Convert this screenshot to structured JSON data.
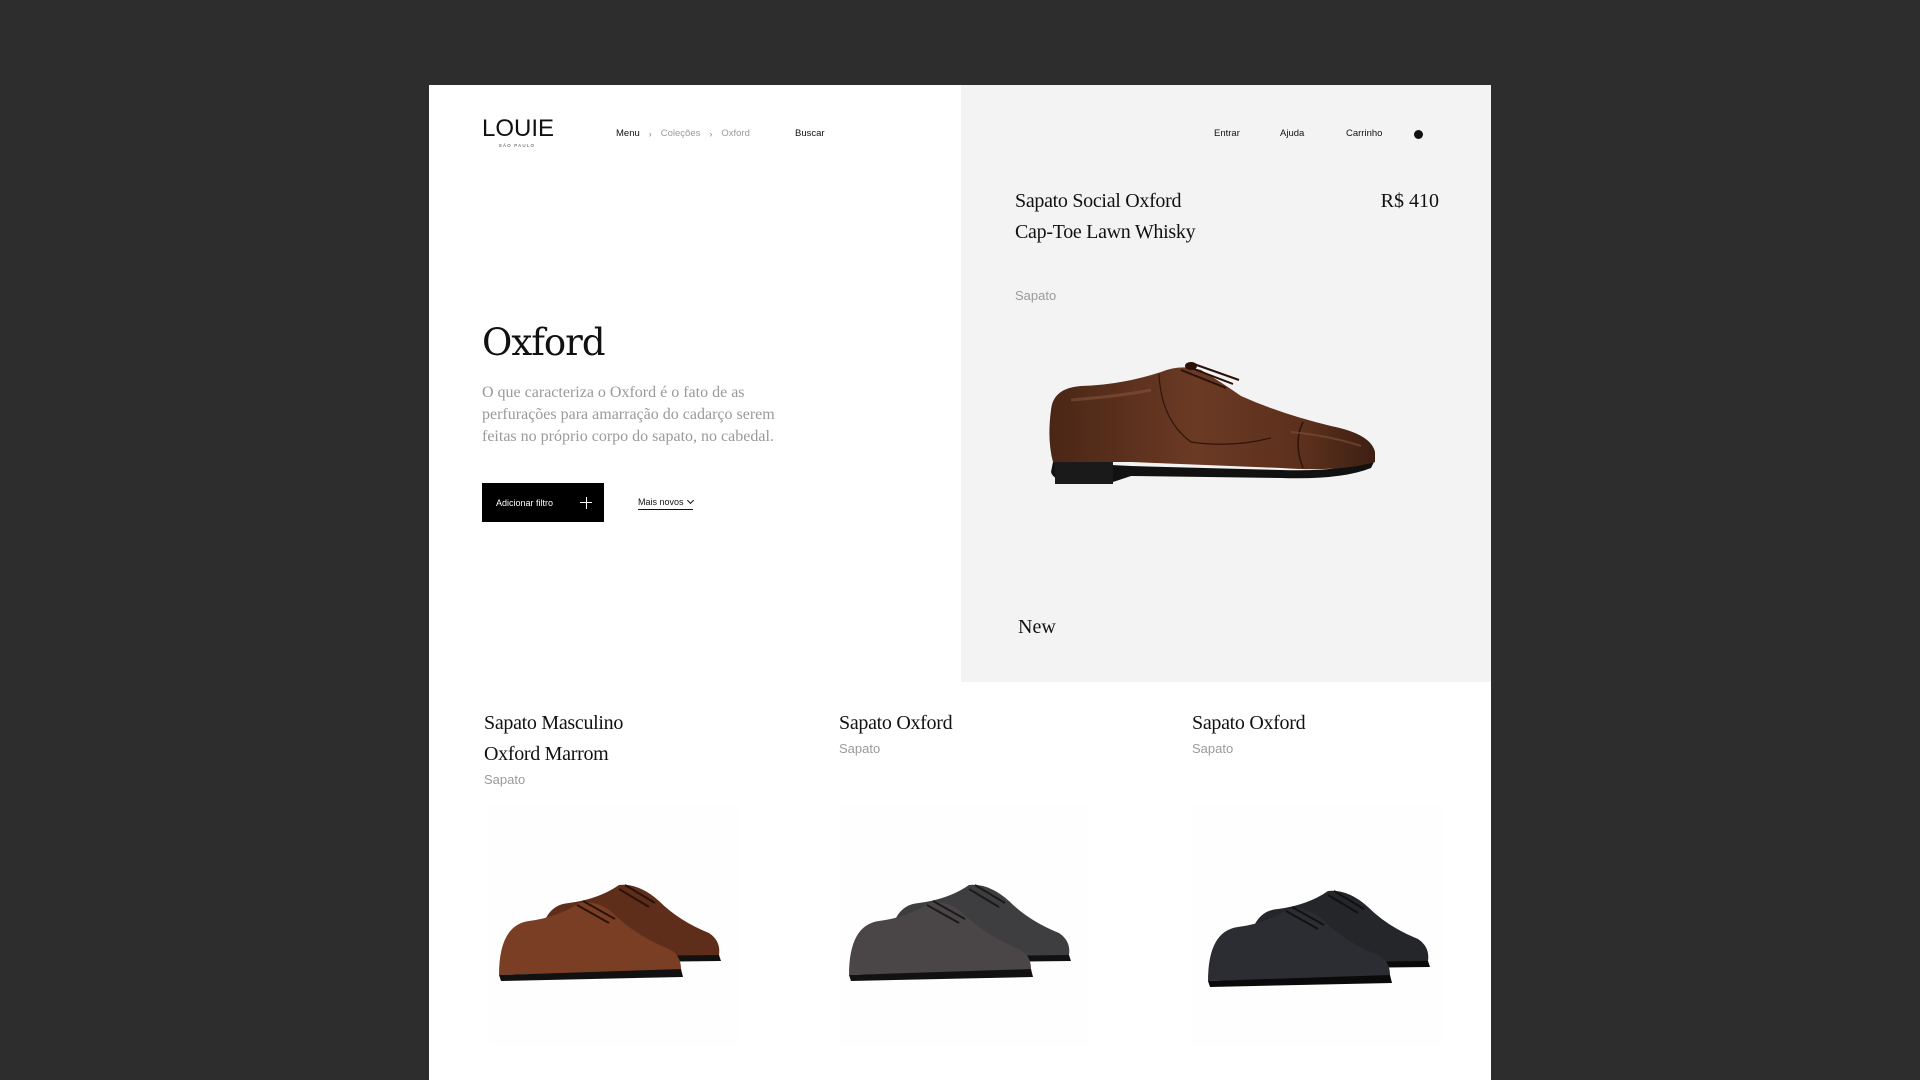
{
  "brand": {
    "name": "LOUIE",
    "sub": "SÃO PAULO"
  },
  "breadcrumb": {
    "items": [
      "Menu",
      "Coleções",
      "Oxford"
    ],
    "sep": "›"
  },
  "search_label": "Buscar",
  "nav": {
    "login": "Entrar",
    "help": "Ajuda",
    "cart": "Carrinho"
  },
  "hero": {
    "title": "Oxford",
    "description": "O que caracteriza o Oxford é o fato de as perfurações para amarração do cadarço serem feitas no próprio corpo do sapato, no cabedal.",
    "filter_button": "Adicionar filtro",
    "sort_label": "Mais novos"
  },
  "featured": {
    "name": "Sapato Social Oxford Cap-Toe Lawn Whisky",
    "price": "R$ 410",
    "category": "Sapato",
    "badge": "New",
    "image_icon": "brown-oxford-shoe-side"
  },
  "products": [
    {
      "name": "Sapato Masculino Oxford Marrom",
      "category": "Sapato",
      "image_icon": "brown-oxford-pair"
    },
    {
      "name": "Sapato Oxford",
      "category": "Sapato",
      "image_icon": "dark-grey-oxford-pair"
    },
    {
      "name": "Sapato Oxford",
      "category": "Sapato",
      "image_icon": "black-oxford-pair"
    }
  ],
  "colors": {
    "background": "#2d2d2d",
    "page": "#ffffff",
    "panel": "#f3f3f3",
    "muted_text": "#9a9a9a",
    "button": "#000000"
  }
}
